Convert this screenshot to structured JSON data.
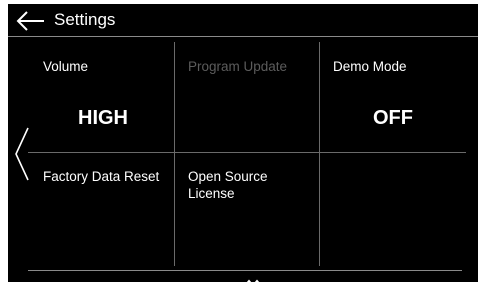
{
  "header": {
    "title": "Settings",
    "back_icon": "back-arrow-icon"
  },
  "navigation": {
    "prev_icon": "chevron-left-icon",
    "page_indicator_icon": "page-indicator-icon"
  },
  "grid": {
    "volume": {
      "label": "Volume",
      "value": "HIGH"
    },
    "program_update": {
      "label": "Program Update",
      "state": "disabled"
    },
    "demo_mode": {
      "label": "Demo Mode",
      "value": "OFF"
    },
    "factory_reset": {
      "label": "Factory Data Reset"
    },
    "open_source": {
      "label": "Open Source License"
    }
  },
  "colors": {
    "background": "#000000",
    "text": "#ffffff",
    "disabled_text": "#5c5c5c",
    "divider": "#6a6a6a"
  }
}
